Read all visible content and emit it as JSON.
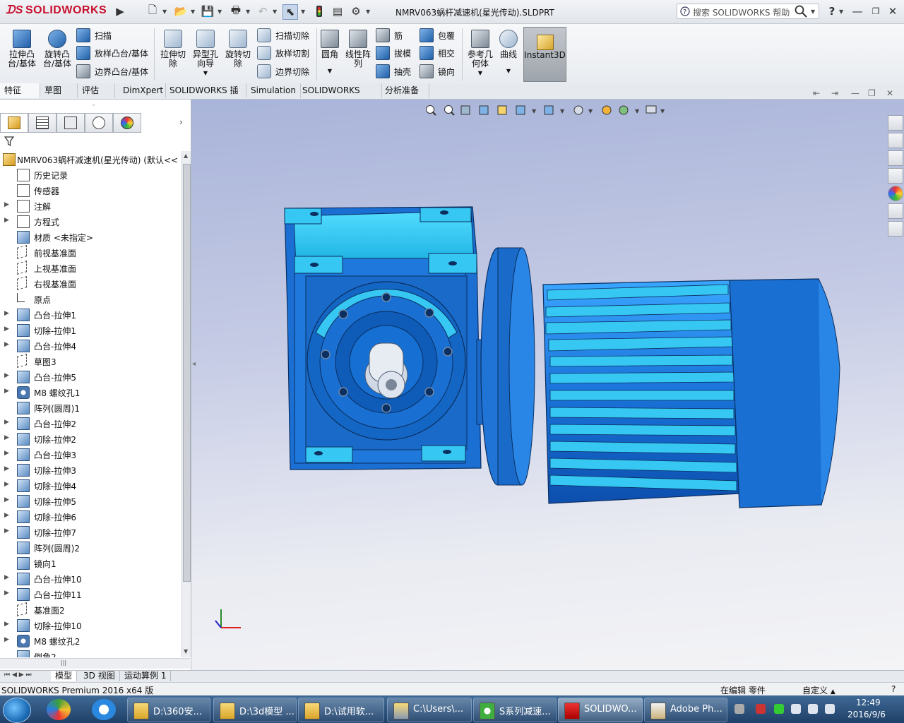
{
  "app": {
    "logo": "SOLIDWORKS",
    "document_title": "NMRV063蜗杆减速机(星光传动).SLDPRT",
    "help_search_placeholder": "搜索 SOLIDWORKS 帮助"
  },
  "commands": {
    "extrude_boss": "拉伸凸\n台/基体",
    "revolve_boss": "旋转凸\n台/基体",
    "sweep": "扫描",
    "loft": "放样凸台/基体",
    "boundary_boss": "边界凸台/基体",
    "extrude_cut": "拉伸切\n除",
    "hole_wizard": "异型孔\n向导",
    "revolve_cut": "旋转切\n除",
    "sweep_cut": "扫描切除",
    "loft_cut": "放样切割",
    "boundary_cut": "边界切除",
    "fillet": "圆角",
    "linear_pattern": "线性阵\n列",
    "rib": "筋",
    "draft": "拔模",
    "shell": "抽壳",
    "wrap": "包覆",
    "intersect": "相交",
    "mirror": "镜向",
    "reference_geometry": "参考几\n何体",
    "curves": "曲线",
    "instant3d": "Instant3D"
  },
  "tabs": [
    "特征",
    "草图",
    "评估",
    "DimXpert",
    "SOLIDWORKS 插件",
    "Simulation",
    "SOLIDWORKS MBD",
    "分析准备"
  ],
  "tree": {
    "root": "NMRV063蜗杆减速机(星光传动)  (默认<<",
    "items": [
      {
        "label": "历史记录",
        "icon": "history-icon",
        "expandable": false
      },
      {
        "label": "传感器",
        "icon": "sensor-icon",
        "expandable": false
      },
      {
        "label": "注解",
        "icon": "annotation-icon",
        "expandable": true
      },
      {
        "label": "方程式",
        "icon": "equation-icon",
        "expandable": true
      },
      {
        "label": "材质 <未指定>",
        "icon": "material-icon",
        "expandable": false
      },
      {
        "label": "前视基准面",
        "icon": "plane-icon",
        "expandable": false
      },
      {
        "label": "上视基准面",
        "icon": "plane-icon",
        "expandable": false
      },
      {
        "label": "右视基准面",
        "icon": "plane-icon",
        "expandable": false
      },
      {
        "label": "原点",
        "icon": "origin-icon",
        "expandable": false
      },
      {
        "label": "凸台-拉伸1",
        "icon": "feature-icon",
        "expandable": true
      },
      {
        "label": "切除-拉伸1",
        "icon": "feature-icon",
        "expandable": true
      },
      {
        "label": "凸台-拉伸4",
        "icon": "feature-icon",
        "expandable": true
      },
      {
        "label": "草图3",
        "icon": "sketch-icon",
        "expandable": false
      },
      {
        "label": "凸台-拉伸5",
        "icon": "feature-icon",
        "expandable": true
      },
      {
        "label": "M8 螺纹孔1",
        "icon": "hole-icon",
        "expandable": true
      },
      {
        "label": "阵列(圆周)1",
        "icon": "pattern-icon",
        "expandable": false
      },
      {
        "label": "凸台-拉伸2",
        "icon": "feature-icon",
        "expandable": true
      },
      {
        "label": "切除-拉伸2",
        "icon": "feature-icon",
        "expandable": true
      },
      {
        "label": "凸台-拉伸3",
        "icon": "feature-icon",
        "expandable": true
      },
      {
        "label": "切除-拉伸3",
        "icon": "feature-icon",
        "expandable": true
      },
      {
        "label": "切除-拉伸4",
        "icon": "feature-icon",
        "expandable": true
      },
      {
        "label": "切除-拉伸5",
        "icon": "feature-icon",
        "expandable": true
      },
      {
        "label": "切除-拉伸6",
        "icon": "feature-icon",
        "expandable": true
      },
      {
        "label": "切除-拉伸7",
        "icon": "feature-icon",
        "expandable": true
      },
      {
        "label": "阵列(圆周)2",
        "icon": "pattern-icon",
        "expandable": false
      },
      {
        "label": "镜向1",
        "icon": "mirror-icon",
        "expandable": false
      },
      {
        "label": "凸台-拉伸10",
        "icon": "feature-icon",
        "expandable": true
      },
      {
        "label": "凸台-拉伸11",
        "icon": "feature-icon",
        "expandable": true
      },
      {
        "label": "基准面2",
        "icon": "plane-icon",
        "expandable": false
      },
      {
        "label": "切除-拉伸10",
        "icon": "feature-icon",
        "expandable": true
      },
      {
        "label": "M8 螺纹孔2",
        "icon": "hole-icon",
        "expandable": true
      },
      {
        "label": "倒角2",
        "icon": "feature-icon",
        "expandable": false
      }
    ]
  },
  "bottom_tabs": [
    "模型",
    "3D 视图",
    "运动算例 1"
  ],
  "status": {
    "left": "SOLIDWORKS Premium 2016 x64 版",
    "mode": "在编辑 零件",
    "units": "自定义"
  },
  "taskbar": {
    "buttons": [
      {
        "label": "D:\\360安...",
        "icon": "folder-icon"
      },
      {
        "label": "D:\\3d模型 ...",
        "icon": "folder-icon"
      },
      {
        "label": "D:\\试用软...",
        "icon": "folder-icon"
      },
      {
        "label": "C:\\Users\\...",
        "icon": "user-folder-icon"
      },
      {
        "label": "S系列减速...",
        "icon": "browser-icon"
      },
      {
        "label": "SOLIDWO...",
        "icon": "solidworks-icon"
      },
      {
        "label": "Adobe Ph...",
        "icon": "photoshop-icon"
      }
    ],
    "time": "12:49",
    "date": "2016/9/6"
  },
  "colors": {
    "accent_red": "#c8102e",
    "model_blue": "#1a73d9",
    "model_cyan": "#27c3f0"
  }
}
